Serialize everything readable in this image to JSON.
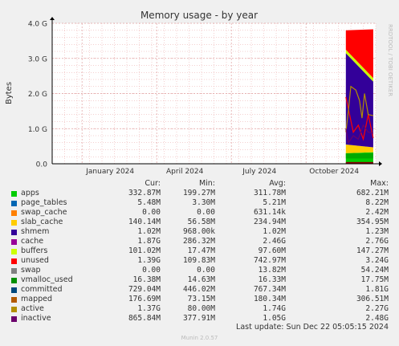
{
  "colors": {
    "background": "#f0f0f0",
    "plot_bg": "#ffffff",
    "grid": "#e8a0a0",
    "axis": "#000000"
  },
  "vertical_label": "RRDTOOL / TOBI OETIKER",
  "munin_version": "Munin 2.0.57",
  "last_update": "Last update: Sun Dec 22 05:05:15 2024",
  "legend_headers": {
    "cur": "Cur:",
    "min": "Min:",
    "avg": "Avg:",
    "max": "Max:"
  },
  "legend": [
    {
      "name": "apps",
      "color": "#00cc00",
      "cur": "332.87M",
      "min": "199.27M",
      "avg": "311.78M",
      "max": "682.21M"
    },
    {
      "name": "page_tables",
      "color": "#0066b3",
      "cur": "5.48M",
      "min": "3.30M",
      "avg": "5.21M",
      "max": "8.22M"
    },
    {
      "name": "swap_cache",
      "color": "#ff8000",
      "cur": "0.00",
      "min": "0.00",
      "avg": "631.14k",
      "max": "2.42M"
    },
    {
      "name": "slab_cache",
      "color": "#ffcc00",
      "cur": "140.14M",
      "min": "56.58M",
      "avg": "234.94M",
      "max": "354.95M"
    },
    {
      "name": "shmem",
      "color": "#330099",
      "cur": "1.02M",
      "min": "968.00k",
      "avg": "1.02M",
      "max": "1.23M"
    },
    {
      "name": "cache",
      "color": "#990099",
      "cur": "1.87G",
      "min": "286.32M",
      "avg": "2.46G",
      "max": "2.76G"
    },
    {
      "name": "buffers",
      "color": "#ccff00",
      "cur": "101.02M",
      "min": "17.47M",
      "avg": "97.60M",
      "max": "147.27M"
    },
    {
      "name": "unused",
      "color": "#ff0000",
      "cur": "1.39G",
      "min": "109.83M",
      "avg": "742.97M",
      "max": "3.24G"
    },
    {
      "name": "swap",
      "color": "#808080",
      "cur": "0.00",
      "min": "0.00",
      "avg": "13.82M",
      "max": "54.24M"
    },
    {
      "name": "vmalloc_used",
      "color": "#008f00",
      "cur": "16.38M",
      "min": "14.63M",
      "avg": "16.33M",
      "max": "17.75M"
    },
    {
      "name": "committed",
      "color": "#00487d",
      "cur": "729.04M",
      "min": "446.02M",
      "avg": "767.34M",
      "max": "1.81G"
    },
    {
      "name": "mapped",
      "color": "#b35a00",
      "cur": "176.69M",
      "min": "73.15M",
      "avg": "180.34M",
      "max": "306.51M"
    },
    {
      "name": "active",
      "color": "#b38f00",
      "cur": "1.37G",
      "min": "80.00M",
      "avg": "1.74G",
      "max": "2.27G"
    },
    {
      "name": "inactive",
      "color": "#6b006b",
      "cur": "865.84M",
      "min": "377.91M",
      "avg": "1.05G",
      "max": "2.48G"
    }
  ],
  "chart_data": {
    "type": "area",
    "title": "Memory usage - by year",
    "ylabel": "Bytes",
    "xlabel": "",
    "ylim": [
      0,
      4.0
    ],
    "y_unit": "G",
    "y_ticks": [
      "0.0",
      "1.0 G",
      "2.0 G",
      "3.0 G",
      "4.0 G"
    ],
    "y_tick_values": [
      0,
      1,
      2,
      3,
      4
    ],
    "x_ticks": [
      "January 2024",
      "April 2024",
      "July 2024",
      "October 2024"
    ],
    "x_tick_month": [
      1.0,
      4.0,
      7.0,
      10.0
    ],
    "x_range_month": [
      -0.2,
      12.8
    ],
    "data_start_month": 11.6,
    "grid": true,
    "stack_top_gigabytes": [
      {
        "month": 11.6,
        "apps": 0.3,
        "slab_cache": 0.25,
        "cache": 2.6,
        "buffers": 0.1,
        "unused": 0.55
      },
      {
        "month": 12.7,
        "apps": 0.33,
        "slab_cache": 0.14,
        "cache": 1.87,
        "buffers": 0.1,
        "unused": 1.39
      }
    ],
    "line_series": {
      "committed": [
        [
          11.6,
          1.9
        ],
        [
          11.75,
          1.4
        ],
        [
          11.9,
          0.9
        ],
        [
          12.1,
          1.1
        ],
        [
          12.3,
          0.7
        ],
        [
          12.5,
          1.4
        ],
        [
          12.7,
          0.73
        ]
      ],
      "active": [
        [
          11.6,
          0.9
        ],
        [
          11.7,
          1.5
        ],
        [
          11.8,
          2.2
        ],
        [
          12.0,
          2.1
        ],
        [
          12.15,
          1.8
        ],
        [
          12.25,
          1.3
        ],
        [
          12.35,
          2.0
        ],
        [
          12.5,
          1.4
        ],
        [
          12.7,
          1.37
        ]
      ],
      "inactive": [
        [
          11.6,
          1.0
        ],
        [
          11.7,
          0.6
        ],
        [
          11.9,
          0.8
        ],
        [
          12.1,
          0.7
        ],
        [
          12.3,
          1.1
        ],
        [
          12.5,
          0.9
        ],
        [
          12.7,
          0.87
        ]
      ]
    }
  }
}
